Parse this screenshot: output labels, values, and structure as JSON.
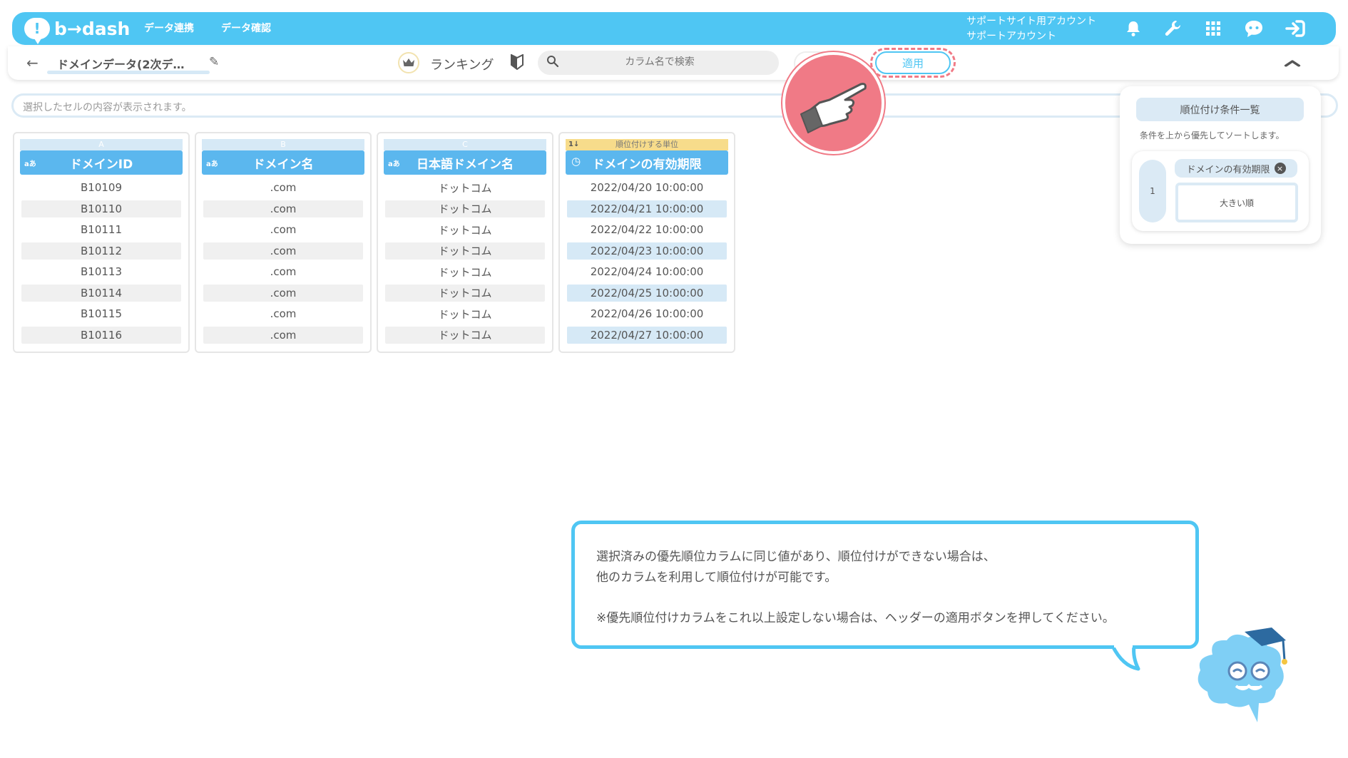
{
  "app": {
    "logo_text": "b→dash",
    "nav": [
      "データ連携",
      "データ確認"
    ],
    "account_line1": "サポートサイト用アカウント",
    "account_line2": "サポートアカウント",
    "icons": [
      "bell-icon",
      "wrench-icon",
      "apps-grid-icon",
      "chat-mascot-icon",
      "logout-icon"
    ]
  },
  "subheader": {
    "back_icon": "←",
    "title": "ドメインデータ(2次デ…",
    "edit_icon": "✎",
    "mode_icon": "♛",
    "mode_label": "ランキング",
    "beginner_icon": "⬟",
    "search_icon": "⌕",
    "search_placeholder": "カラム名で検索",
    "apply_label": "適用",
    "collapse_icon": "︿"
  },
  "cell_preview_placeholder": "選択したセルの内容が表示されます。",
  "table": {
    "columns": [
      {
        "letter": "A",
        "type_badge": "aあ",
        "header": "ドメインID",
        "highlight": false,
        "values": [
          "B10109",
          "B10110",
          "B10111",
          "B10112",
          "B10113",
          "B10114",
          "B10115",
          "B10116"
        ]
      },
      {
        "letter": "B",
        "type_badge": "aあ",
        "header": "ドメイン名",
        "highlight": false,
        "values": [
          ".com",
          ".com",
          ".com",
          ".com",
          ".com",
          ".com",
          ".com",
          ".com"
        ]
      },
      {
        "letter": "C",
        "type_badge": "aあ",
        "header": "日本語ドメイン名",
        "highlight": false,
        "values": [
          "ドットコム",
          "ドットコム",
          "ドットコム",
          "ドットコム",
          "ドットコム",
          "ドットコム",
          "ドットコム",
          "ドットコム"
        ]
      },
      {
        "letter": "順位付けする単位",
        "sort_badge": "1↓",
        "type_badge": "◷",
        "header": "ドメインの有効期限",
        "highlight": true,
        "values": [
          "2022/04/20 10:00:00",
          "2022/04/21 10:00:00",
          "2022/04/22 10:00:00",
          "2022/04/23 10:00:00",
          "2022/04/24 10:00:00",
          "2022/04/25 10:00:00",
          "2022/04/26 10:00:00",
          "2022/04/27 10:00:00"
        ]
      }
    ]
  },
  "rank_panel": {
    "title": "順位付け条件一覧",
    "description": "条件を上から優先してソートします。",
    "conditions": [
      {
        "priority": "1",
        "column": "ドメインの有効期限",
        "order": "大きい順"
      }
    ]
  },
  "tooltip": {
    "line1": "選択済みの優先順位カラムに同じ値があり、順位付けができない場合は、",
    "line2": "他のカラムを利用して順位付けが可能です。",
    "line3": "※優先順位付けカラムをこれ以上設定しない場合は、ヘッダーの適用ボタンを押してください。"
  },
  "colors": {
    "brand": "#4fc6f3",
    "header_blue": "#5bb7ee",
    "highlight_row": "#d6e9f6",
    "rank_unit_yellow": "#f7dc8b",
    "pointer_pink": "#f07a86"
  }
}
